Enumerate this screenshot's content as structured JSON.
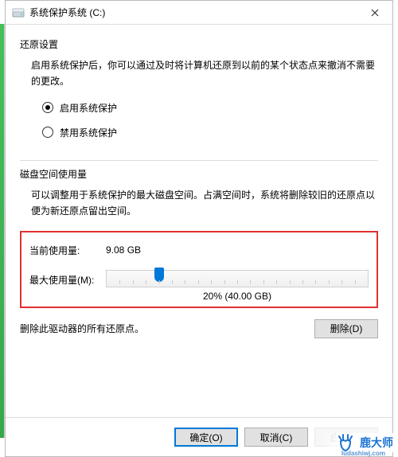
{
  "title": "系统保护系统 (C:)",
  "restore": {
    "section_title": "还原设置",
    "description": "启用系统保护后，你可以通过及时将计算机还原到以前的某个状态点来撤消不需要的更改。",
    "option_on": "启用系统保护",
    "option_off": "禁用系统保护",
    "selected": "on"
  },
  "disk": {
    "section_title": "磁盘空间使用量",
    "description": "可以调整用于系统保护的最大磁盘空间。占满空间时，系统将删除较旧的还原点以便为新还原点留出空间。",
    "current_label": "当前使用量:",
    "current_value": "9.08 GB",
    "max_label": "最大使用量(M):",
    "slider_percent": 20,
    "slider_display": "20% (40.00 GB)"
  },
  "delete": {
    "text": "删除此驱动器的所有还原点。",
    "button": "删除(D)"
  },
  "buttons": {
    "ok": "确定(O)",
    "cancel": "取消(C)",
    "apply": "应用(A)"
  },
  "watermark": {
    "name": "鹿大师",
    "url": "ludashiwj.com"
  }
}
